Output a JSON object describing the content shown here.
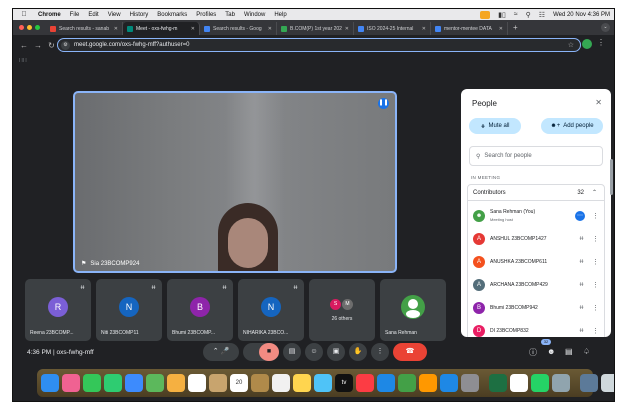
{
  "menubar": {
    "app": "Chrome",
    "items": [
      "File",
      "Edit",
      "View",
      "History",
      "Bookmarks",
      "Profiles",
      "Tab",
      "Window",
      "Help"
    ],
    "datetime": "Wed 20 Nov  4:36 PM"
  },
  "tabs": [
    {
      "title": "Search results - sanab",
      "color": "#ea4335"
    },
    {
      "title": "Meet - oxs-fwhg-m",
      "color": "#00897b"
    },
    {
      "title": "Search results - Goog",
      "color": "#4285f4"
    },
    {
      "title": "B.COM(P) 1st year 202",
      "color": "#34a853"
    },
    {
      "title": "ISO 2024-25 Internal",
      "color": "#4285f4"
    },
    {
      "title": "mentor-mentee DATA",
      "color": "#4285f4"
    }
  ],
  "address": {
    "url": "meet.google.com/oxs-fwhg-mff?authuser=0"
  },
  "main_video": {
    "name": "Sia 23BCOMP924"
  },
  "thumbnails": [
    {
      "initial": "R",
      "name": "Reena 23BCOMP...",
      "color": "#7b5fd6"
    },
    {
      "initial": "N",
      "name": "Niti 23BCOMP11",
      "color": "#1565c0"
    },
    {
      "initial": "B",
      "name": "Bhumi 23BCOMP...",
      "color": "#8e24aa"
    },
    {
      "initial": "N",
      "name": "NIHARIKA 23BCO...",
      "color": "#1565c0"
    },
    {
      "others_text": "26 others",
      "mini": [
        {
          "initial": "S",
          "color": "#d81b60"
        },
        {
          "initial": "M",
          "color": "#6d6d6d"
        }
      ]
    },
    {
      "name": "Sana Rehman"
    }
  ],
  "meeting": {
    "time": "4:36 PM",
    "separator": "|",
    "code": "oxs-fwhg-mff"
  },
  "participants_badge": "32",
  "panel": {
    "title": "People",
    "mute_all": "Mute all",
    "add_people": "Add people",
    "search_placeholder": "Search for people",
    "section": "IN MEETING",
    "contributors_label": "Contributors",
    "contributors_count": "32",
    "people": [
      {
        "name": "Sana Rehman (You)",
        "sub": "Meeting host",
        "color": "#43a047"
      },
      {
        "initial": "A",
        "name": "ANSHUL 23BCOMP1427",
        "color": "#e53935"
      },
      {
        "initial": "A",
        "name": "ANUSHKA 23BCOMP611",
        "color": "#f4511e"
      },
      {
        "initial": "A",
        "name": "ARCHANA 23BCOMP429",
        "color": "#546e7a"
      },
      {
        "initial": "B",
        "name": "Bhumi 23BCOMP942",
        "color": "#8e24aa"
      },
      {
        "initial": "D",
        "name": "DI 23BCOMP832",
        "color": "#e91e63"
      }
    ]
  },
  "dock": {
    "icons": [
      {
        "name": "finder",
        "color": "#2f8ef0"
      },
      {
        "name": "launchpad",
        "color": "#f06292"
      },
      {
        "name": "messages",
        "color": "#34c759"
      },
      {
        "name": "facetime",
        "color": "#2ecc71"
      },
      {
        "name": "mail",
        "color": "#3d8bfd"
      },
      {
        "name": "maps",
        "color": "#5cb85c"
      },
      {
        "name": "photos",
        "color": "#f5b041"
      },
      {
        "name": "chrome",
        "color": "#ffffff"
      },
      {
        "name": "contacts",
        "color": "#c8a46e"
      },
      {
        "name": "calendar",
        "color": "#ffffff",
        "label": "20"
      },
      {
        "name": "notes-brown",
        "color": "#b08a4a"
      },
      {
        "name": "reminders",
        "color": "#f1f1f1"
      },
      {
        "name": "notes",
        "color": "#ffd54f"
      },
      {
        "name": "freeform",
        "color": "#4fc3f7"
      },
      {
        "name": "appletv",
        "color": "#111111",
        "label": "tv"
      },
      {
        "name": "music",
        "color": "#fc3c44"
      },
      {
        "name": "keynote",
        "color": "#1e88e5"
      },
      {
        "name": "numbers",
        "color": "#43a047"
      },
      {
        "name": "pages",
        "color": "#ff9800"
      },
      {
        "name": "appstore",
        "color": "#1e88e5"
      },
      {
        "name": "settings",
        "color": "#8e8e93"
      },
      {
        "name": "sep"
      },
      {
        "name": "excel",
        "color": "#1d6f42"
      },
      {
        "name": "chrome2",
        "color": "#ffffff"
      },
      {
        "name": "whatsapp",
        "color": "#25d366"
      },
      {
        "name": "preview",
        "color": "#90a4ae"
      },
      {
        "name": "sep"
      },
      {
        "name": "downloads",
        "color": "#5c7a99"
      },
      {
        "name": "trash",
        "color": "#cfd8dc"
      }
    ]
  }
}
